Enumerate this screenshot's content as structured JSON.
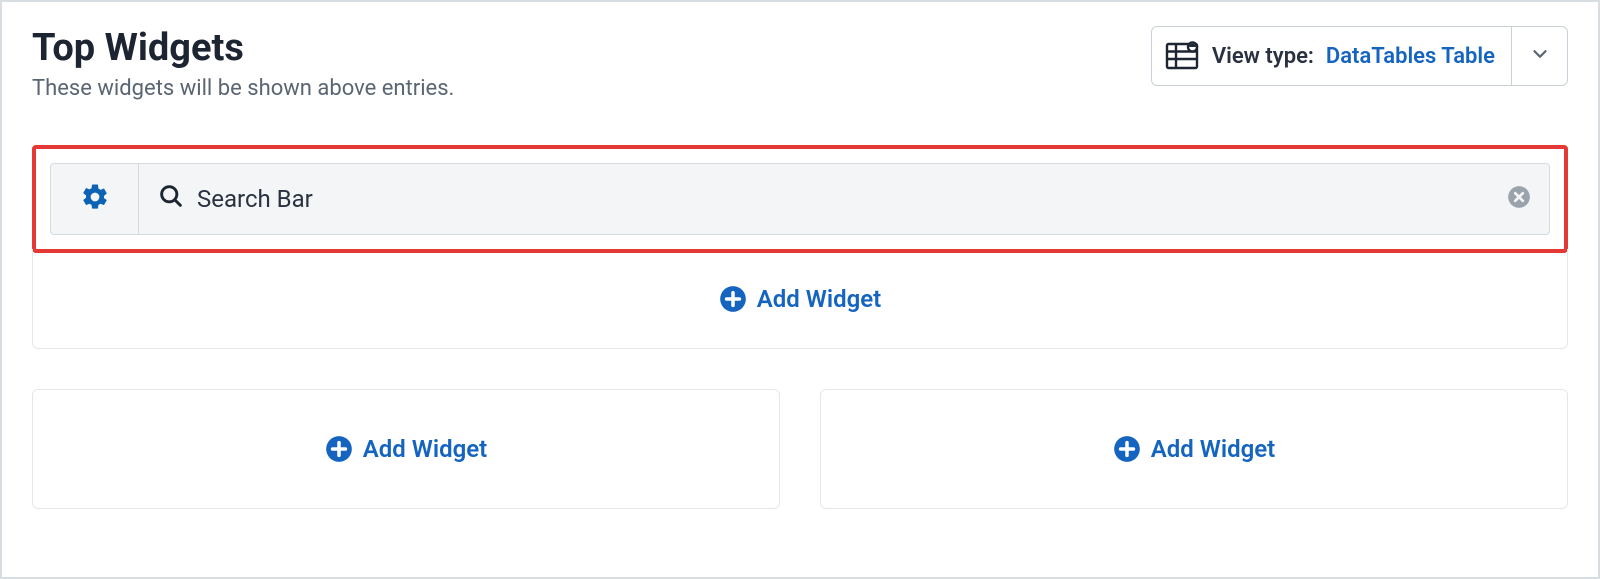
{
  "header": {
    "title": "Top Widgets",
    "subtitle": "These widgets will be shown above entries."
  },
  "view_type": {
    "label": "View type:",
    "value": "DataTables Table"
  },
  "widget": {
    "name": "Search Bar"
  },
  "actions": {
    "add_widget": "Add Widget"
  }
}
